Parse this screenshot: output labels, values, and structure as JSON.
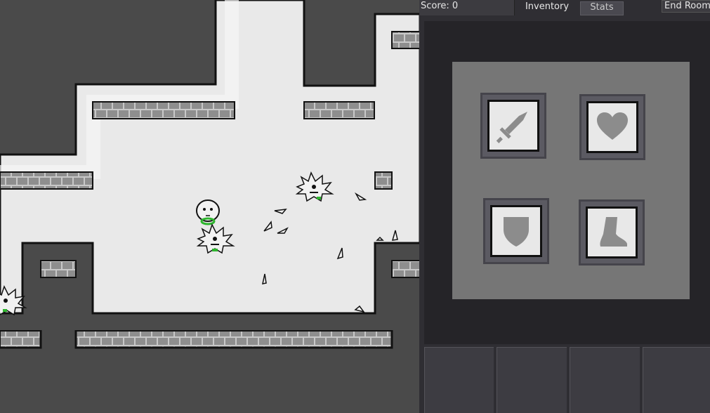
{
  "hud": {
    "score_text": "Score: 0",
    "tabs": [
      {
        "label": "Inventory",
        "active": true
      },
      {
        "label": "Stats",
        "active": false
      }
    ],
    "end_room_label": "End Room"
  },
  "inventory": {
    "slots": [
      {
        "name": "sword",
        "icon": "sword-icon"
      },
      {
        "name": "heart",
        "icon": "heart-icon"
      },
      {
        "name": "shield",
        "icon": "shield-icon"
      },
      {
        "name": "boot",
        "icon": "boot-icon"
      }
    ],
    "hotbar_slots": 4
  },
  "colors": {
    "floor": "#e9e9e9",
    "wall": "#4a4a4a",
    "panel": "#2f2e33",
    "inventory_grid": "#767676",
    "icon_gray": "#8c8c8c",
    "player_accent": "#2db52d"
  }
}
